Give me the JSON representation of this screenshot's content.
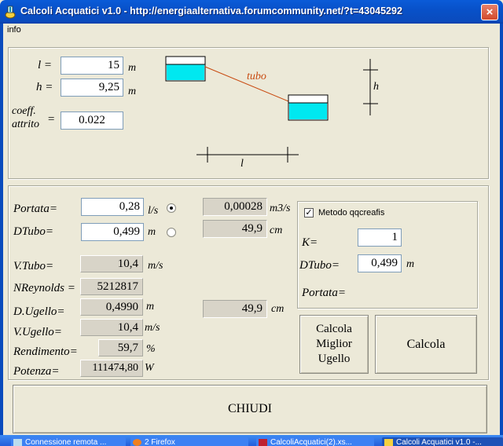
{
  "window": {
    "title": "Calcoli Acquatici v1.0 - http://energiaalternativa.forumcommunity.net/?t=43045292",
    "close_glyph": "×"
  },
  "menu": {
    "info": "info"
  },
  "pipe": {
    "l_label": "l =",
    "l_value": "15",
    "l_unit": "m",
    "h_label": "h =",
    "h_value": "9,25",
    "h_unit": "m",
    "coeff_label_1": "coeff.",
    "coeff_label_2": "attrito",
    "coeff_eq": "=",
    "coeff_value": "0.022"
  },
  "diagram": {
    "tubo": "tubo",
    "h": "h",
    "l": "l",
    "tank_color": "#00e8f0",
    "pipe_color": "#c84a10"
  },
  "calc": {
    "portata_label": "Portata=",
    "portata_value": "0,28",
    "portata_unit": "l/s",
    "portata_m3s_value": "0,00028",
    "portata_m3s_unit": "m3/s",
    "dtubo_label": "DTubo=",
    "dtubo_value": "0,499",
    "dtubo_unit": "m",
    "dtubo_cm_value": "49,9",
    "dtubo_cm_unit": "cm",
    "radio_portata_selected": true,
    "radio_dtubo_selected": false,
    "vtubo_label": "V.Tubo=",
    "vtubo_value": "10,4",
    "vtubo_unit": "m/s",
    "nreynolds_label": "NReynolds =",
    "nreynolds_value": "5212817",
    "dugello_label": "D.Ugello=",
    "dugello_value": "0,4990",
    "dugello_unit": "m",
    "dugello_cm_value": "49,9",
    "dugello_cm_unit": "cm",
    "vugello_label": "V.Ugello=",
    "vugello_value": "10,4",
    "vugello_unit": "m/s",
    "rendimento_label": "Rendimento=",
    "rendimento_value": "59,7",
    "rendimento_unit": "%",
    "potenza_label": "Potenza=",
    "potenza_value": "111474,80",
    "potenza_unit": "W"
  },
  "method": {
    "checkbox_label": "Metodo qqcreafis",
    "checked": true,
    "check_glyph": "✓",
    "k_label": "K=",
    "k_value": "1",
    "dtubo_label": "DTubo=",
    "dtubo_value": "0,499",
    "dtubo_unit": "m",
    "portata_label": "Portata="
  },
  "buttons": {
    "miglior_1": "Calcola",
    "miglior_2": "Miglior",
    "miglior_3": "Ugello",
    "calcola": "Calcola",
    "chiudi": "CHIUDI"
  },
  "taskbar": {
    "items": [
      "Connessione remota ...",
      "2 Firefox",
      "CalcoliAcquatici(2).xs...",
      "Calcoli Acquatici v1.0 -..."
    ]
  }
}
